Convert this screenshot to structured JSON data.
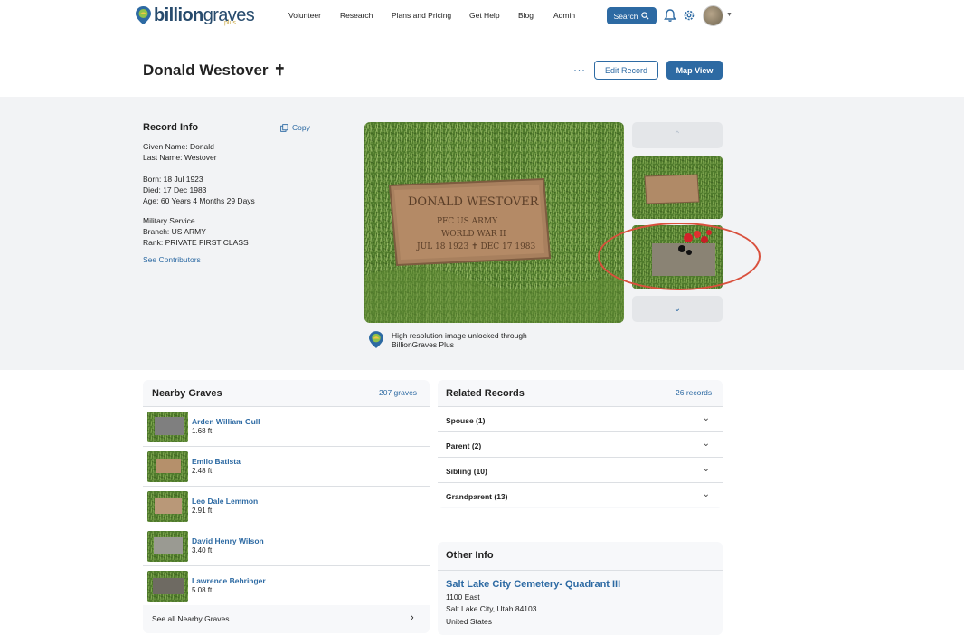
{
  "header": {
    "logo_text_bold": "billion",
    "logo_text_light": "graves",
    "logo_plus": "plus",
    "nav": [
      "Volunteer",
      "Research",
      "Plans and Pricing",
      "Get Help",
      "Blog",
      "Admin"
    ],
    "search_label": "Search"
  },
  "record": {
    "name": "Donald Westover",
    "cross_symbol": "✝",
    "more_label": "···",
    "edit_label": "Edit Record",
    "map_label": "Map View"
  },
  "record_info": {
    "title": "Record Info",
    "copy_label": "Copy",
    "given_name": "Given Name: Donald",
    "last_name": "Last Name: Westover",
    "born": "Born: 18 Jul 1923",
    "died": "Died: 17 Dec 1983",
    "age": "Age: 60 Years 4 Months 29 Days",
    "military": "Military Service",
    "branch": "Branch: US ARMY",
    "rank": "Rank: PRIVATE FIRST CLASS",
    "contributors_link": "See Contributors"
  },
  "photo": {
    "headstone_name": "DONALD WESTOVER",
    "headstone_line2": "PFC   US ARMY",
    "headstone_line3": "WORLD WAR II",
    "headstone_line4": "JUL 18 1923   ✝   DEC 17 1983",
    "hires_line1": "High resolution image unlocked through",
    "hires_line2": "BillionGraves Plus"
  },
  "nearby": {
    "title": "Nearby Graves",
    "count": "207 graves",
    "items": [
      {
        "name": "Arden William Gull",
        "distance": "1.68 ft"
      },
      {
        "name": "Emilo Batista",
        "distance": "2.48 ft"
      },
      {
        "name": "Leo Dale Lemmon",
        "distance": "2.91 ft"
      },
      {
        "name": "David Henry Wilson",
        "distance": "3.40 ft"
      },
      {
        "name": "Lawrence Behringer",
        "distance": "5.08 ft"
      }
    ],
    "see_all": "See all Nearby Graves"
  },
  "related": {
    "title": "Related Records",
    "count": "26 records",
    "items": [
      {
        "label": "Spouse (1)"
      },
      {
        "label": "Parent (2)"
      },
      {
        "label": "Sibling (10)"
      },
      {
        "label": "Grandparent (13)"
      }
    ]
  },
  "other_info": {
    "title": "Other Info",
    "cemetery": "Salt Lake City Cemetery- Quadrant III",
    "address1": "1100 East",
    "address2": "Salt Lake City, Utah 84103",
    "country": "United States"
  },
  "colors": {
    "brand_blue": "#2d6aa3",
    "band_grey": "#f2f3f5",
    "annotation_red": "#d9503d"
  }
}
